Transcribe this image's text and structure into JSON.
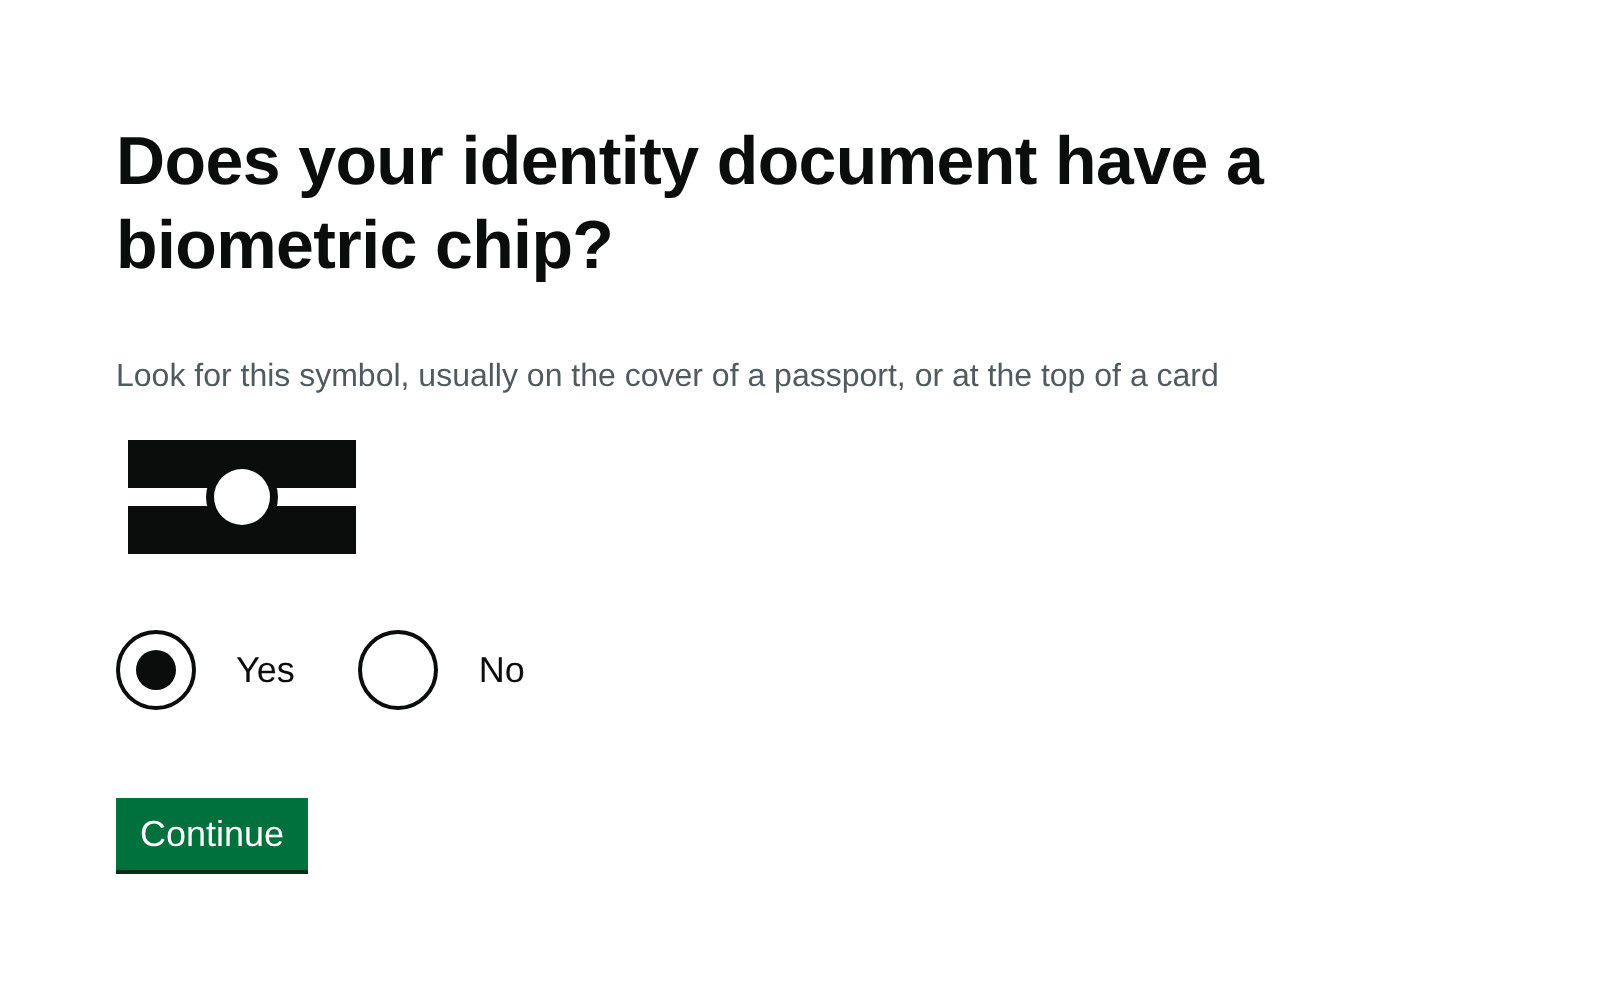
{
  "heading": "Does your identity document have a biometric chip?",
  "hint": "Look for this symbol, usually on the cover of a passport, or at the top of a card",
  "options": [
    {
      "label": "Yes",
      "selected": true
    },
    {
      "label": "No",
      "selected": false
    }
  ],
  "button": "Continue"
}
